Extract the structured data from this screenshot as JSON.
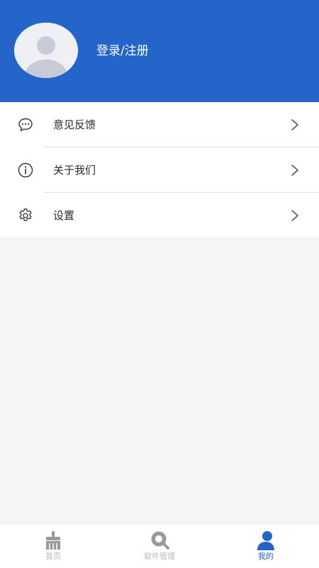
{
  "header": {
    "login_label": "登录/注册"
  },
  "menu": {
    "items": [
      {
        "label": "意见反馈",
        "icon": "chat-bubble-icon"
      },
      {
        "label": "关于我们",
        "icon": "info-icon"
      },
      {
        "label": "设置",
        "icon": "gear-icon"
      }
    ]
  },
  "tabbar": {
    "tabs": [
      {
        "label": "首页",
        "icon": "broom-icon",
        "active": false
      },
      {
        "label": "软件管理",
        "icon": "search-icon",
        "active": false
      },
      {
        "label": "我的",
        "icon": "user-icon",
        "active": true
      }
    ]
  },
  "colors": {
    "primary": "#2465c9",
    "background": "#f6f5f6",
    "inactive": "#b9b9b9"
  }
}
